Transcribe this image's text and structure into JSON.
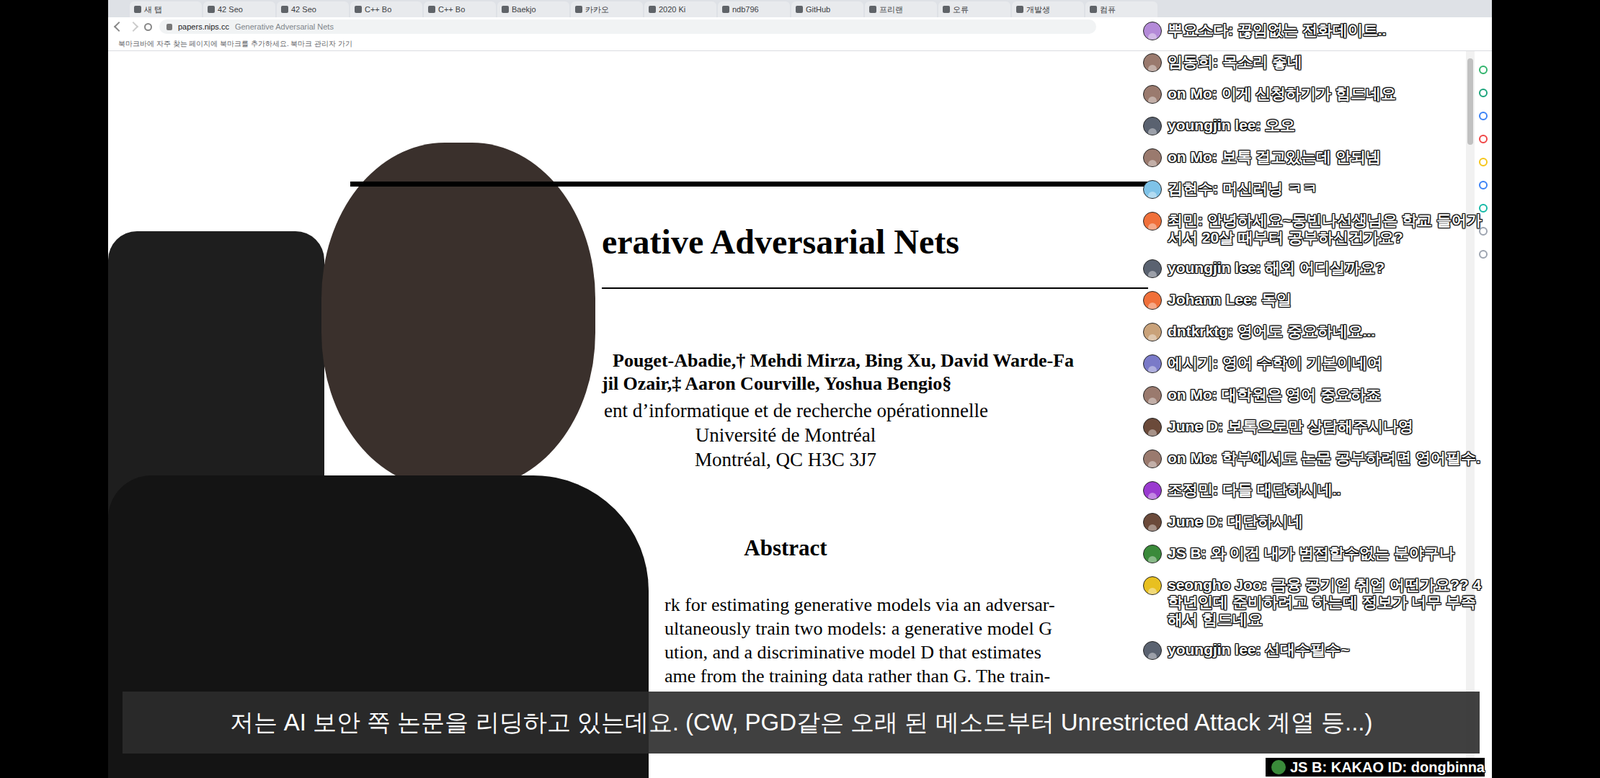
{
  "browser": {
    "tabs": [
      {
        "label": "새 탭",
        "selected": false
      },
      {
        "label": "42 Seo",
        "selected": false
      },
      {
        "label": "42 Seo",
        "selected": false
      },
      {
        "label": "C++ Bo",
        "selected": false
      },
      {
        "label": "C++ Bo",
        "selected": false
      },
      {
        "label": "Baekjo",
        "selected": false
      },
      {
        "label": "카카오",
        "selected": false
      },
      {
        "label": "2020 Ki",
        "selected": false
      },
      {
        "label": "ndb796",
        "selected": false
      },
      {
        "label": "GitHub",
        "selected": false
      },
      {
        "label": "프리랜",
        "selected": false
      },
      {
        "label": "오류",
        "selected": false
      },
      {
        "label": "개발생",
        "selected": false
      },
      {
        "label": "컴퓨",
        "selected": false
      }
    ],
    "address": "papers.nips.cc",
    "page_title": "Generative Adversarial Nets",
    "bookmark_bar": "북마크바에 자주 찾는 페이지에 북마크를 추가하세요. 북마크 관리자 가기"
  },
  "paper": {
    "title": "erative Adversarial Nets",
    "authors": [
      "Pouget-Abadie,† Mehdi Mirza, Bing Xu, David Warde-Fa",
      "jil Ozair,‡ Aaron Courville, Yoshua Bengio§"
    ],
    "affiliation": [
      "ent d’informatique et de recherche opérationnelle",
      "Université de Montréal",
      "Montréal, QC H3C 3J7"
    ],
    "abstract_heading": "Abstract",
    "abstract_lines": [
      "rk for estimating generative models via an adversar-",
      "ultaneously train two models: a generative model G",
      "ution, and a discriminative model D that estimates",
      "ame from the training data rather than G. The train-"
    ]
  },
  "chat": [
    {
      "name": "뿌요소다:",
      "message": "끊임없는 전화데이트..",
      "color": "#b48ad8"
    },
    {
      "name": "임동희:",
      "message": "목소리 좋네",
      "color": "#9a7a6e"
    },
    {
      "name": "on Mo:",
      "message": "이게 신청하기가 힘드네요",
      "color": "#9a7a6e"
    },
    {
      "name": "youngjin lee:",
      "message": "오오",
      "color": "#5a6270"
    },
    {
      "name": "on Mo:",
      "message": "보톡 걸고있는데 안되넴",
      "color": "#9a7a6e"
    },
    {
      "name": "김현수:",
      "message": "머신러닝 ㅋㅋ",
      "color": "#7fc3e8"
    },
    {
      "name": "최민:",
      "message": "안녕하세요~동빈나선생님은 학교 들어가서서 20살 때부터 공부하신건가요?",
      "color": "#f0703a"
    },
    {
      "name": "youngjin lee:",
      "message": "해외 어디실까요?",
      "color": "#5a6270"
    },
    {
      "name": "Johann Lee:",
      "message": "독일",
      "color": "#f0703a"
    },
    {
      "name": "dntkrktg:",
      "message": "영어도 중요하네요...",
      "color": "#c9a27a"
    },
    {
      "name": "에시기:",
      "message": "영어 수학이 기본이네여",
      "color": "#7a7ac8"
    },
    {
      "name": "on Mo:",
      "message": "대학원은 영어 중요하죠",
      "color": "#9a7a6e"
    },
    {
      "name": "June D:",
      "message": "보톡으로만 상담해주시나영",
      "color": "#6b4a3a"
    },
    {
      "name": "on Mo:",
      "message": "학부에서도 논문 공부하려면 영어필수.",
      "color": "#9a7a6e"
    },
    {
      "name": "조정민:",
      "message": "다들 대단하시네..",
      "color": "#9a3ad0"
    },
    {
      "name": "June D:",
      "message": "대단하시네",
      "color": "#6b4a3a"
    },
    {
      "name": "JS B:",
      "message": "와 이건 내가 범접할수없는 분야구나",
      "color": "#3a8a3a"
    },
    {
      "name": "seongho Joo:",
      "message": "금융 공기업 취업 어떤가요?? 4학년인데 준비하려고 하는데 정보가 너무 부족해서 힘드네요",
      "color": "#e8c020"
    },
    {
      "name": "youngjin lee:",
      "message": "선대수필수~",
      "color": "#5a6270"
    }
  ],
  "subtitle": "저는 AI 보안 쪽 논문을 리딩하고 있는데요. (CW, PGD같은 오래 된 메소드부터 Unrestricted Attack 계열 등...)",
  "footer_chat": {
    "name": "JS B:",
    "message": "KAKAO ID: dongbinna"
  }
}
